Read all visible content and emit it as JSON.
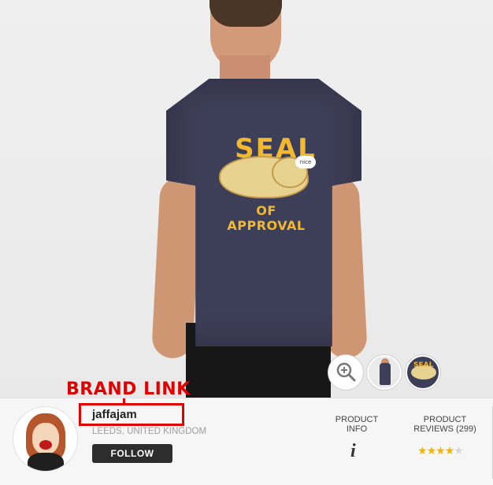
{
  "product_image": {
    "design_title": "SEAL",
    "design_subtitle": "OF APPROVAL",
    "speech_bubble": "nice"
  },
  "annotation": {
    "label": "BRAND LINK",
    "color": "#e00000"
  },
  "artist": {
    "name": "jaffajam",
    "location": "LEEDS, UNITED KINGDOM",
    "follow_label": "FOLLOW"
  },
  "tabs": {
    "product_info": {
      "line1": "PRODUCT",
      "line2": "INFO"
    },
    "product_reviews": {
      "line1": "PRODUCT",
      "line2": "REVIEWS (299)"
    }
  },
  "rating": {
    "stars_filled": 4,
    "stars_total": 5
  },
  "colors": {
    "tshirt": "#3d3e57",
    "design_yellow": "#f2b830",
    "star": "#f5b400"
  }
}
